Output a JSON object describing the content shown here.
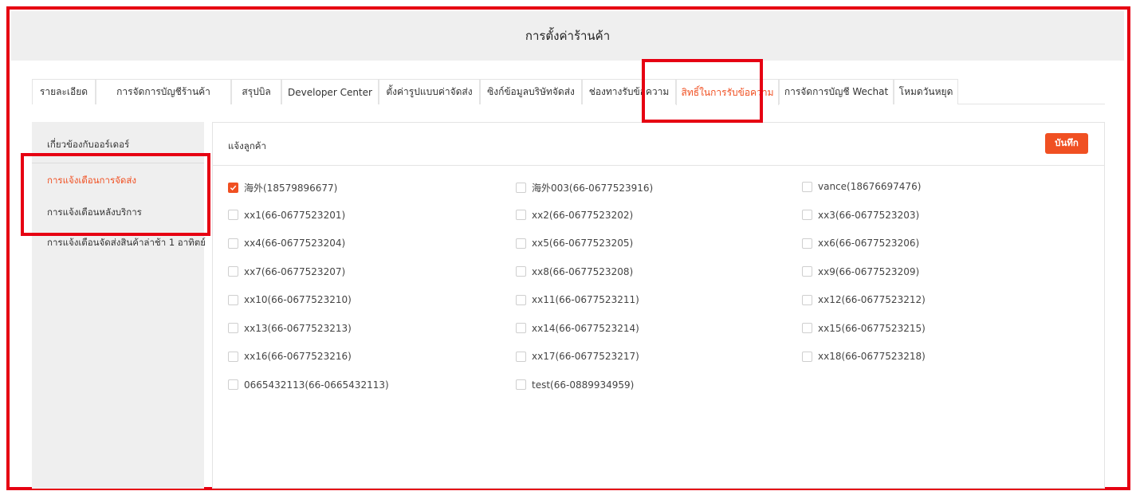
{
  "page": {
    "title": "การตั้งค่าร้านค้า"
  },
  "tabs": [
    {
      "label": "รายละเอียด",
      "active": false
    },
    {
      "label": "การจัดการบัญชีร้านค้า",
      "active": false
    },
    {
      "label": "สรุปบิล",
      "active": false
    },
    {
      "label": "Developer Center",
      "active": false
    },
    {
      "label": "ตั้งค่ารูปแบบค่าจัดส่ง",
      "active": false
    },
    {
      "label": "ซิงก์ข้อมูลบริษัทจัดส่ง",
      "active": false
    },
    {
      "label": "ช่องทางรับข้อความ",
      "active": false
    },
    {
      "label": "สิทธิ์ในการรับข้อความ",
      "active": true
    },
    {
      "label": "การจัดการบัญชี Wechat",
      "active": false
    },
    {
      "label": "โหมดวันหยุด",
      "active": false
    }
  ],
  "sidebar": {
    "items": [
      {
        "label": "เกี่ยวข้องกับออร์เดอร์",
        "active": false
      },
      {
        "label": "การแจ้งเตือนการจัดส่ง",
        "active": true
      },
      {
        "label": "การแจ้งเตือนหลังบริการ",
        "active": false
      },
      {
        "label": "การแจ้งเตือนจัดส่งสินค้าล่าช้า 1 อาทิตย์",
        "active": false
      }
    ]
  },
  "panel": {
    "title": "แจ้งลูกค้า",
    "save_label": "บันทึก",
    "contacts": [
      {
        "label": "海外(18579896677)",
        "checked": true
      },
      {
        "label": "海外003(66-0677523916)",
        "checked": false
      },
      {
        "label": "vance(18676697476)",
        "checked": false
      },
      {
        "label": "xx1(66-0677523201)",
        "checked": false
      },
      {
        "label": "xx2(66-0677523202)",
        "checked": false
      },
      {
        "label": "xx3(66-0677523203)",
        "checked": false
      },
      {
        "label": "xx4(66-0677523204)",
        "checked": false
      },
      {
        "label": "xx5(66-0677523205)",
        "checked": false
      },
      {
        "label": "xx6(66-0677523206)",
        "checked": false
      },
      {
        "label": "xx7(66-0677523207)",
        "checked": false
      },
      {
        "label": "xx8(66-0677523208)",
        "checked": false
      },
      {
        "label": "xx9(66-0677523209)",
        "checked": false
      },
      {
        "label": "xx10(66-0677523210)",
        "checked": false
      },
      {
        "label": "xx11(66-0677523211)",
        "checked": false
      },
      {
        "label": "xx12(66-0677523212)",
        "checked": false
      },
      {
        "label": "xx13(66-0677523213)",
        "checked": false
      },
      {
        "label": "xx14(66-0677523214)",
        "checked": false
      },
      {
        "label": "xx15(66-0677523215)",
        "checked": false
      },
      {
        "label": "xx16(66-0677523216)",
        "checked": false
      },
      {
        "label": "xx17(66-0677523217)",
        "checked": false
      },
      {
        "label": "xx18(66-0677523218)",
        "checked": false
      },
      {
        "label": "0665432113(66-0665432113)",
        "checked": false
      },
      {
        "label": "test(66-0889934959)",
        "checked": false
      }
    ]
  },
  "colors": {
    "accent": "#f05022",
    "highlight": "#e60012",
    "header_bg": "#efefef"
  }
}
